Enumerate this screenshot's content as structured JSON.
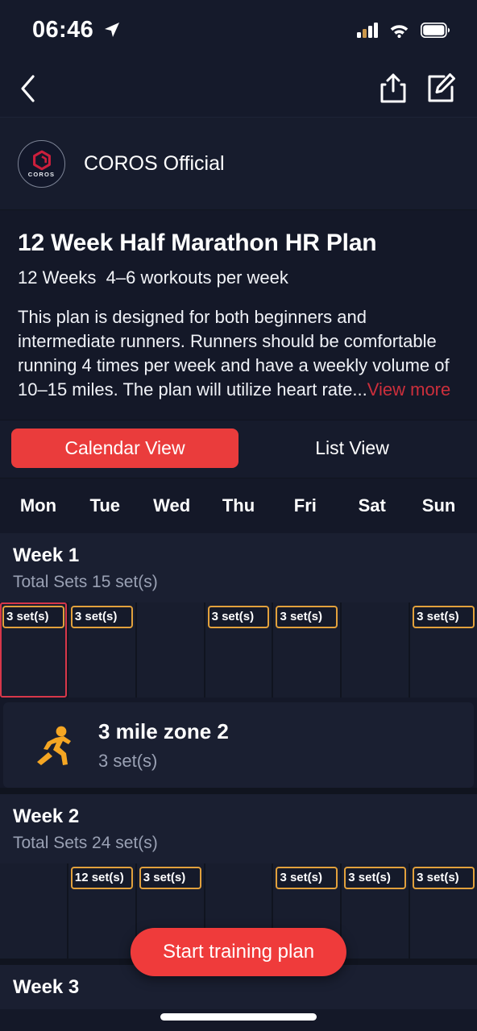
{
  "status_bar": {
    "time": "06:46",
    "location_icon": "location-arrow-icon",
    "cellular_icon": "cellular-signal-icon",
    "wifi_icon": "wifi-icon",
    "battery_icon": "battery-full-icon"
  },
  "nav": {
    "back_icon": "chevron-left-icon",
    "share_icon": "share-icon",
    "edit_icon": "edit-compose-icon"
  },
  "author": {
    "name": "COROS Official",
    "logo_word": "COROS",
    "logo_icon": "coros-hex-logo-icon"
  },
  "plan": {
    "title": "12 Week Half Marathon HR Plan",
    "duration": "12 Weeks",
    "frequency": "4–6 workouts per week",
    "description": "This plan is designed for both beginners and intermediate runners. Runners should be comfortable running 4 times per week and have a weekly volume of 10–15 miles. The plan will utilize heart rate...",
    "view_more": "View more"
  },
  "tabs": [
    {
      "label": "Calendar View",
      "active": true
    },
    {
      "label": "List View",
      "active": false
    }
  ],
  "weekdays": [
    "Mon",
    "Tue",
    "Wed",
    "Thu",
    "Fri",
    "Sat",
    "Sun"
  ],
  "weeks": [
    {
      "title": "Week 1",
      "total_sets": "Total Sets 15 set(s)",
      "days": [
        {
          "badge": "3 set(s)",
          "selected": true
        },
        {
          "badge": "3 set(s)",
          "selected": false
        },
        {
          "badge": "",
          "selected": false
        },
        {
          "badge": "3 set(s)",
          "selected": false
        },
        {
          "badge": "3 set(s)",
          "selected": false
        },
        {
          "badge": "",
          "selected": false
        },
        {
          "badge": "3 set(s)",
          "selected": false
        }
      ],
      "workout": {
        "icon": "running-person-icon",
        "title": "3 mile zone 2",
        "sets": "3 set(s)"
      }
    },
    {
      "title": "Week 2",
      "total_sets": "Total Sets 24 set(s)",
      "days": [
        {
          "badge": "",
          "selected": false
        },
        {
          "badge": "12 set(s)",
          "selected": false
        },
        {
          "badge": "3 set(s)",
          "selected": false
        },
        {
          "badge": "",
          "selected": false
        },
        {
          "badge": "3 set(s)",
          "selected": false
        },
        {
          "badge": "3 set(s)",
          "selected": false
        },
        {
          "badge": "3 set(s)",
          "selected": false
        }
      ]
    },
    {
      "title": "Week 3",
      "total_sets": "",
      "days": []
    }
  ],
  "start_button": {
    "label": "Start training plan"
  },
  "colors": {
    "accent_red": "#ef3b3b",
    "link_red": "#cc2f3c",
    "badge_orange": "#e2a13c",
    "selection_red": "#d7374a",
    "background": "#141828",
    "surface": "#1a1f31",
    "icon_orange": "#f5a623"
  }
}
